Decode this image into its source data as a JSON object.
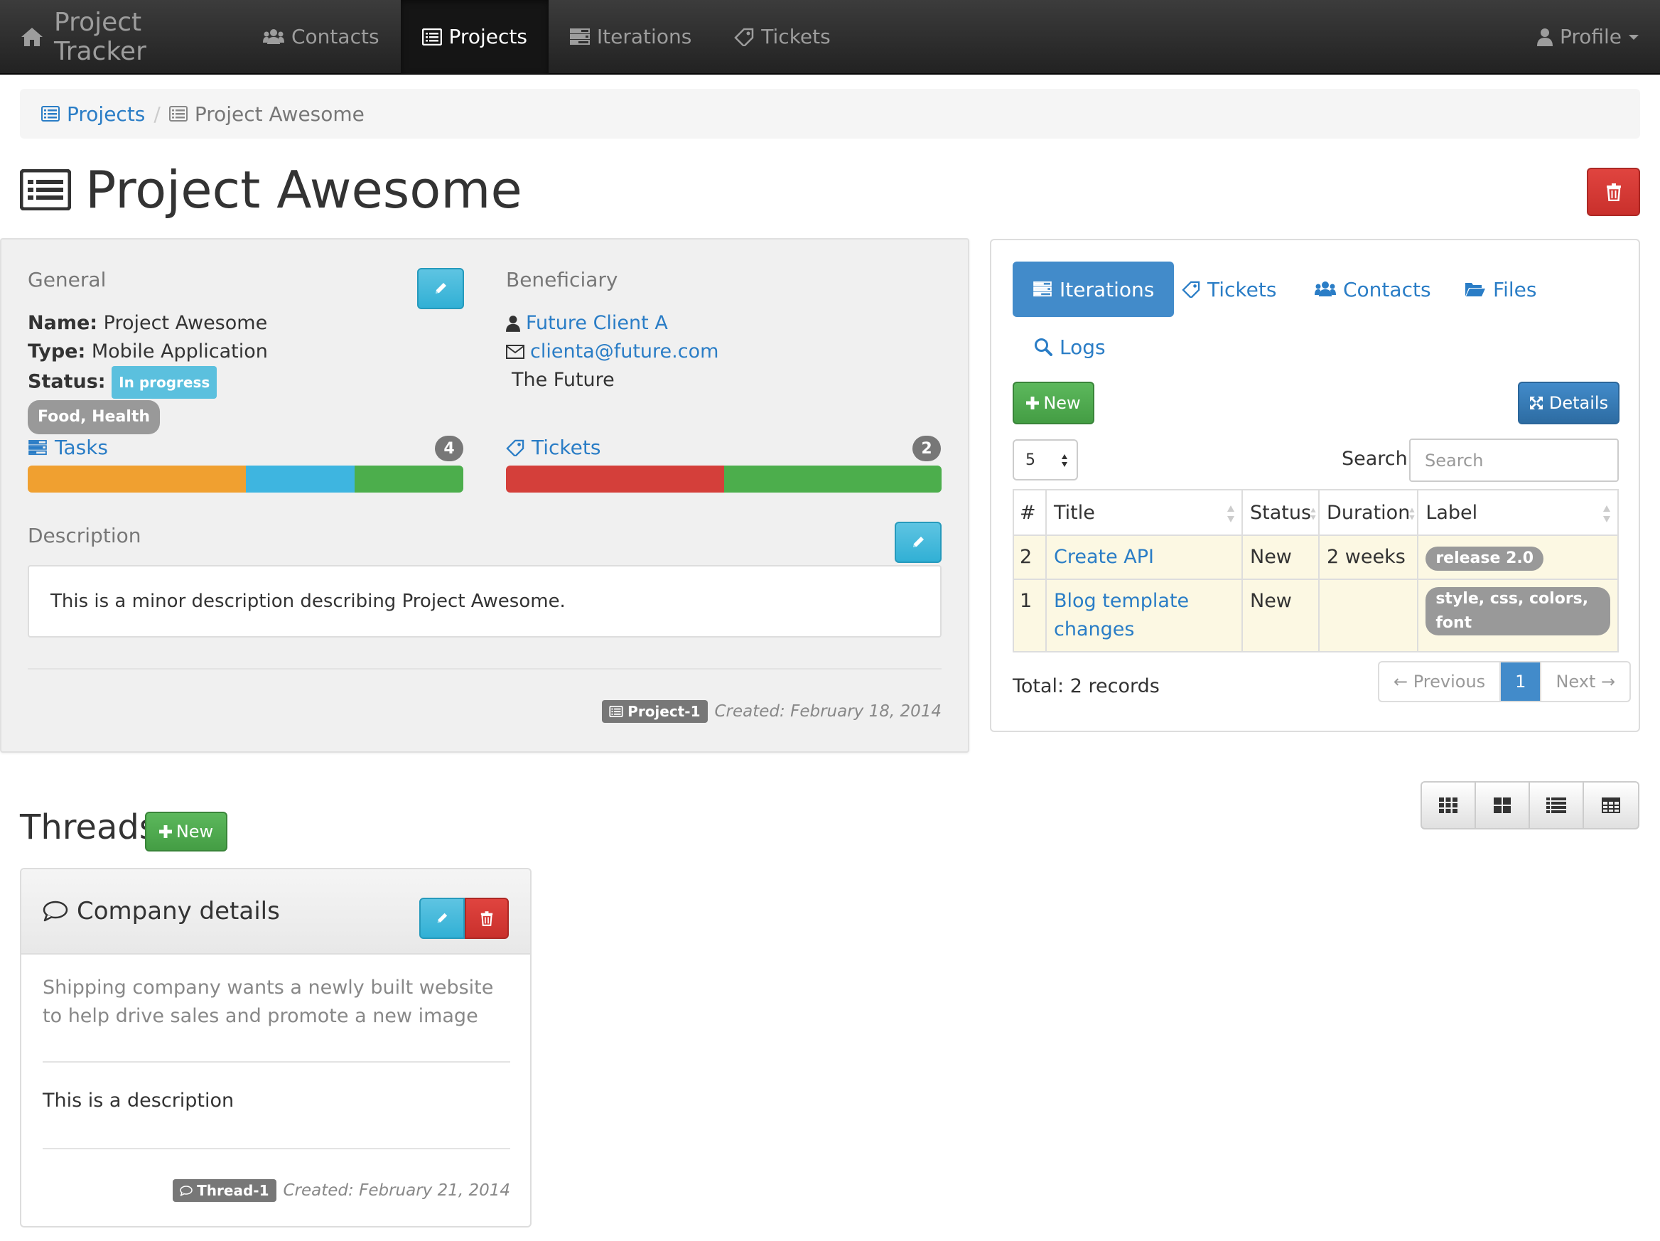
{
  "navbar": {
    "brand": "Project Tracker",
    "items": [
      {
        "label": "Contacts",
        "icon": "users-icon"
      },
      {
        "label": "Projects",
        "icon": "list-alt-icon",
        "active": true
      },
      {
        "label": "Iterations",
        "icon": "tasks-icon"
      },
      {
        "label": "Tickets",
        "icon": "tag-icon"
      }
    ],
    "profile": "Profile"
  },
  "breadcrumb": {
    "parent": "Projects",
    "current": "Project Awesome"
  },
  "page": {
    "title": "Project Awesome"
  },
  "general": {
    "heading": "General",
    "name_label": "Name:",
    "name": "Project Awesome",
    "type_label": "Type:",
    "type": "Mobile Application",
    "status_label": "Status:",
    "status": "In progress",
    "tags": "Food, Health"
  },
  "beneficiary": {
    "heading": "Beneficiary",
    "name": "Future Client A",
    "email": "clienta@future.com",
    "location": "The Future"
  },
  "tasks": {
    "label": "Tasks",
    "count": "4",
    "segments": [
      {
        "fraction": 0.5,
        "color": "#f0a030"
      },
      {
        "fraction": 0.25,
        "color": "#3eb5e0"
      },
      {
        "fraction": 0.25,
        "color": "#4cae4c"
      }
    ]
  },
  "tickets": {
    "label": "Tickets",
    "count": "2",
    "segments": [
      {
        "fraction": 0.5,
        "color": "#d43f3a"
      },
      {
        "fraction": 0.5,
        "color": "#4cae4c"
      }
    ]
  },
  "description": {
    "heading": "Description",
    "text": "This is a minor description describing Project Awesome."
  },
  "project_meta": {
    "id": "Project-1",
    "created": "Created: February 18, 2014"
  },
  "right_panel": {
    "tabs": [
      {
        "label": "Iterations",
        "icon": "tasks-icon",
        "active": true
      },
      {
        "label": "Tickets",
        "icon": "tag-icon"
      },
      {
        "label": "Contacts",
        "icon": "users-icon"
      },
      {
        "label": "Files",
        "icon": "folder-open-icon"
      },
      {
        "label": "Logs",
        "icon": "search-icon"
      }
    ],
    "new_label": "New",
    "details_label": "Details",
    "page_size": "5",
    "search_label": "Search:",
    "search_placeholder": "Search",
    "columns": [
      "#",
      "Title",
      "Status",
      "Duration",
      "Label"
    ],
    "rows": [
      {
        "num": "2",
        "title": "Create API",
        "status": "New",
        "duration": "2 weeks",
        "label": "release 2.0"
      },
      {
        "num": "1",
        "title": "Blog template changes",
        "status": "New",
        "duration": "",
        "label": "style, css, colors, font"
      }
    ],
    "total": "Total: 2 records",
    "pager": {
      "prev": "← Previous",
      "current": "1",
      "next": "Next →"
    }
  },
  "threads": {
    "heading": "Threads",
    "new_label": "New",
    "items": [
      {
        "title": "Company details",
        "summary": "Shipping company wants a newly built website to help drive sales and promote a new image",
        "description": "This is a description",
        "id": "Thread-1",
        "created": "Created: February 21, 2014"
      }
    ]
  },
  "colors": {
    "primary": "#428bca",
    "info": "#5bc0de",
    "success": "#5cb85c",
    "danger": "#d9534f",
    "link": "#2a7dc6"
  }
}
